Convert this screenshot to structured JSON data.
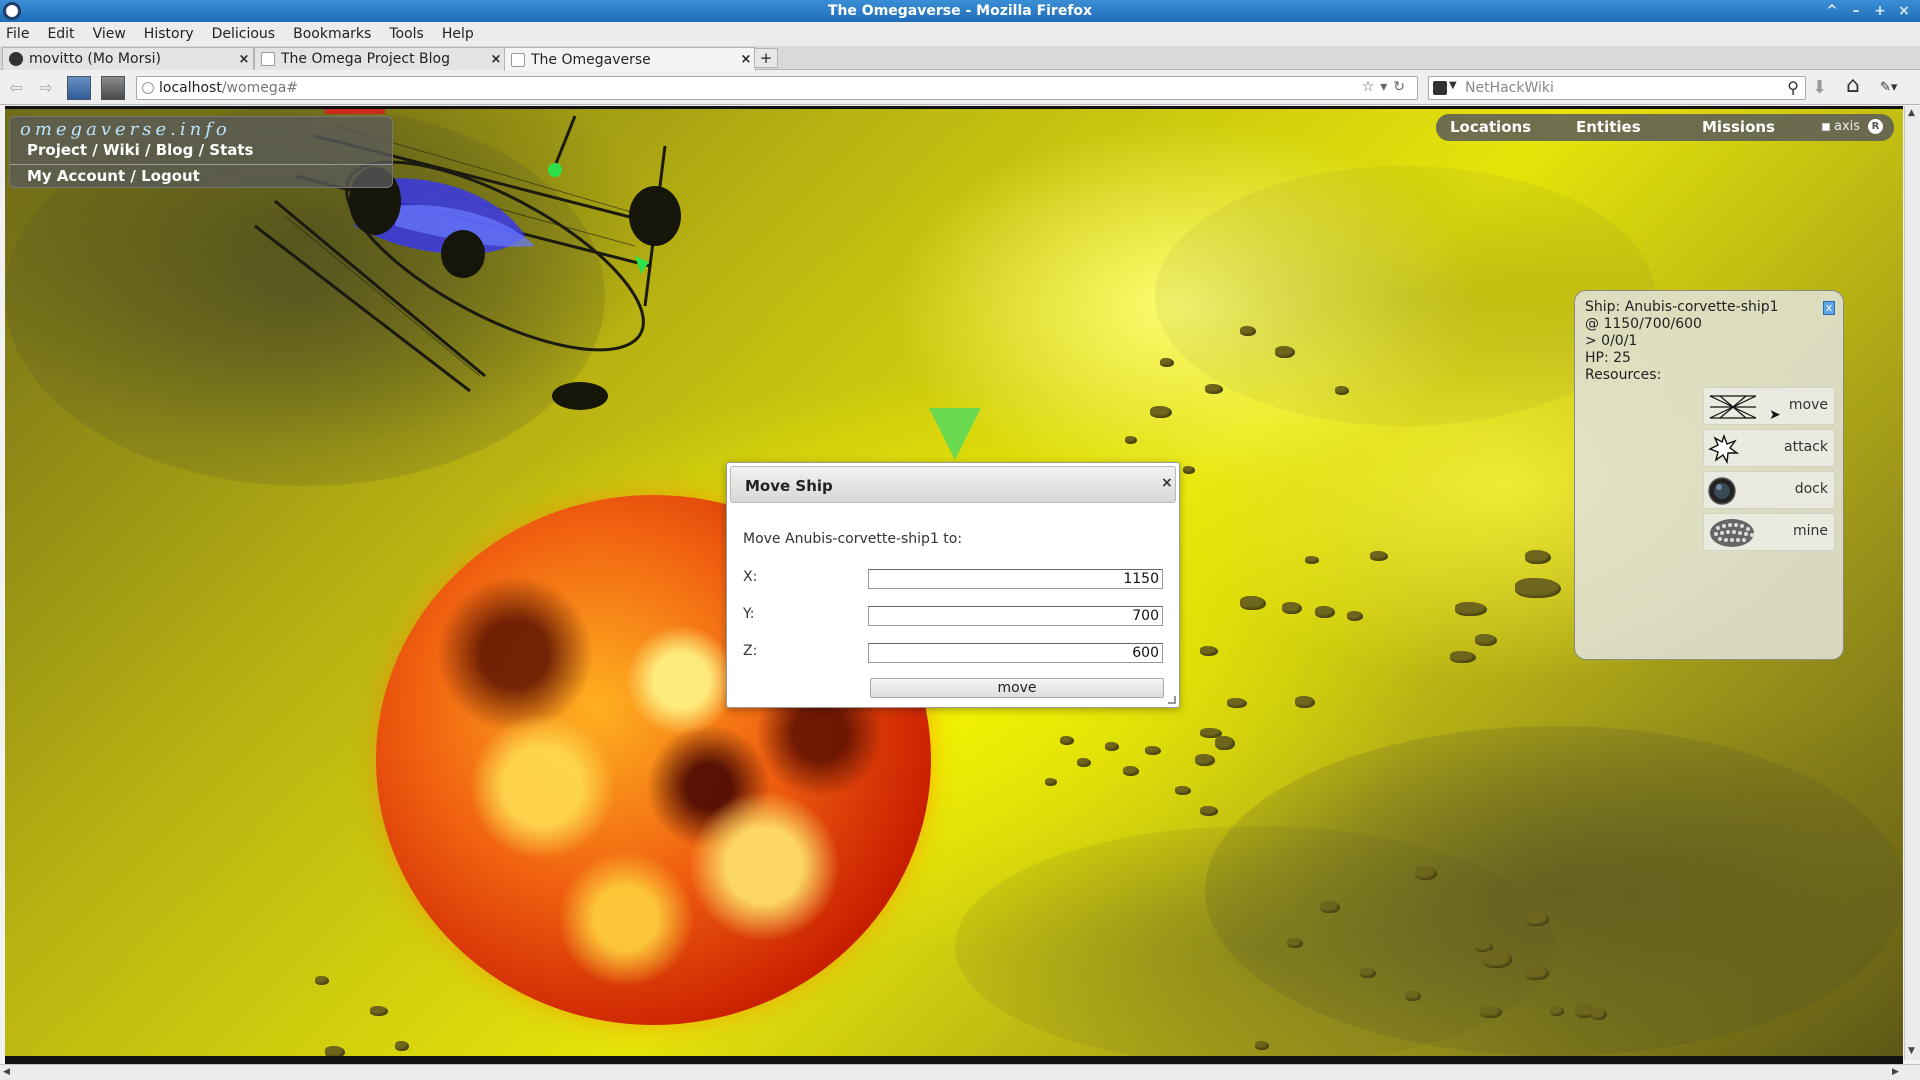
{
  "window": {
    "title": "The Omegaverse - Mozilla Firefox",
    "controls": [
      "^",
      "–",
      "+",
      "×"
    ]
  },
  "menubar": [
    "File",
    "Edit",
    "View",
    "History",
    "Delicious",
    "Bookmarks",
    "Tools",
    "Help"
  ],
  "tabs": [
    {
      "label": "movitto (Mo Morsi)",
      "close": "×",
      "active": false,
      "favicon": "github-icon"
    },
    {
      "label": "The Omega Project Blog",
      "close": "×",
      "active": false,
      "favicon": "page-icon"
    },
    {
      "label": "The Omegaverse",
      "close": "×",
      "active": true,
      "favicon": "page-icon"
    }
  ],
  "new_tab_label": "+",
  "navbar": {
    "url_host": "localhost",
    "url_path": "/womega#",
    "search_engine": "NetHackWiki",
    "url_actions": "☆▾↻",
    "back_icon": "⇦",
    "forward_icon": "⇨",
    "search_icon_glyph": "⚲",
    "download_icon_glyph": "⬇",
    "home_icon_glyph": "⌂",
    "extension_icon_glyph": "✎▾"
  },
  "site_nav": {
    "brand": "omegaverse.info",
    "links_line": "Project / Wiki / Blog / Stats",
    "account_line": "My Account / Logout"
  },
  "game_menu": {
    "items": [
      "Locations",
      "Entities",
      "Missions"
    ],
    "axis_label": "axis",
    "reset_label": "R",
    "axis_checked": false
  },
  "entity_panel": {
    "ship_line": "Ship: Anubis-corvette-ship1",
    "location_line": "@ 1150/700/600",
    "orientation_line": "> 0/0/1",
    "hp_line": "HP: 25",
    "resources_line": "Resources:",
    "close_label": "x",
    "commands": [
      {
        "label": "move",
        "icon": "move-icon"
      },
      {
        "label": "attack",
        "icon": "attack-icon"
      },
      {
        "label": "dock",
        "icon": "dock-icon"
      },
      {
        "label": "mine",
        "icon": "mine-icon"
      }
    ]
  },
  "dialog": {
    "title": "Move Ship",
    "close_label": "×",
    "prompt": "Move Anubis-corvette-ship1 to:",
    "x_label": "X:",
    "y_label": "Y:",
    "z_label": "Z:",
    "x_value": "1150",
    "y_value": "700",
    "z_value": "600",
    "button_label": "move"
  },
  "colors": {
    "titlebar": "#1f6db8",
    "space_yellow": "#e6e40a",
    "star_core": "#f06010",
    "marker_green": "#3cdc6e"
  }
}
